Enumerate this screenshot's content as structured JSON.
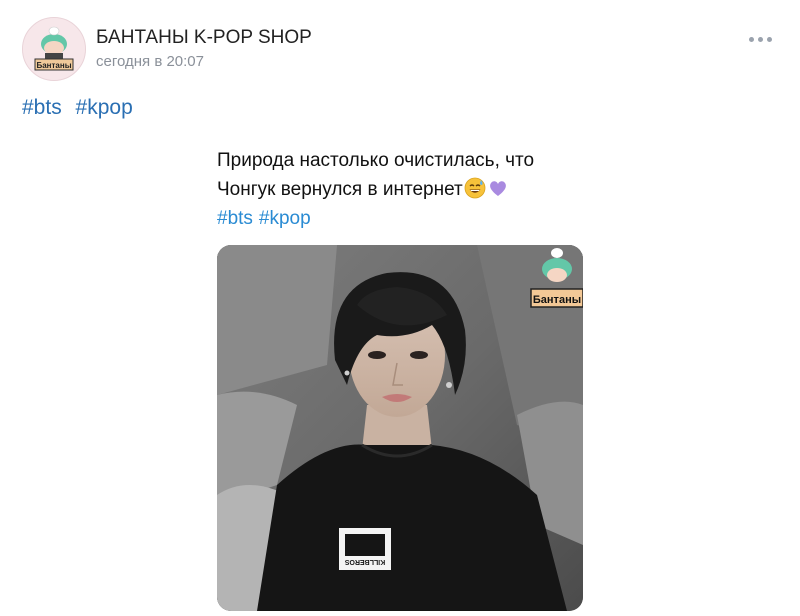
{
  "post": {
    "author": "БАНТАНЫ K-POP SHOP",
    "time": "сегодня в 20:07",
    "avatar_badge": "Бантаны",
    "hashtags": [
      "#bts",
      "#kpop"
    ]
  },
  "image_post": {
    "caption_line1": "Природа настолько очистилась, что",
    "caption_line2": "Чонгук вернулся в интернет",
    "emojis": [
      "sweat-smile-emoji",
      "purple-heart-emoji"
    ],
    "hashtags": [
      "#bts",
      "#kpop"
    ],
    "watermark": "Бантаны",
    "shirt_text": "KILLBEROS"
  },
  "colors": {
    "hashtag": "#2a6fb3",
    "caption_hashtag": "#2a8bd3",
    "time": "#8a9099"
  }
}
